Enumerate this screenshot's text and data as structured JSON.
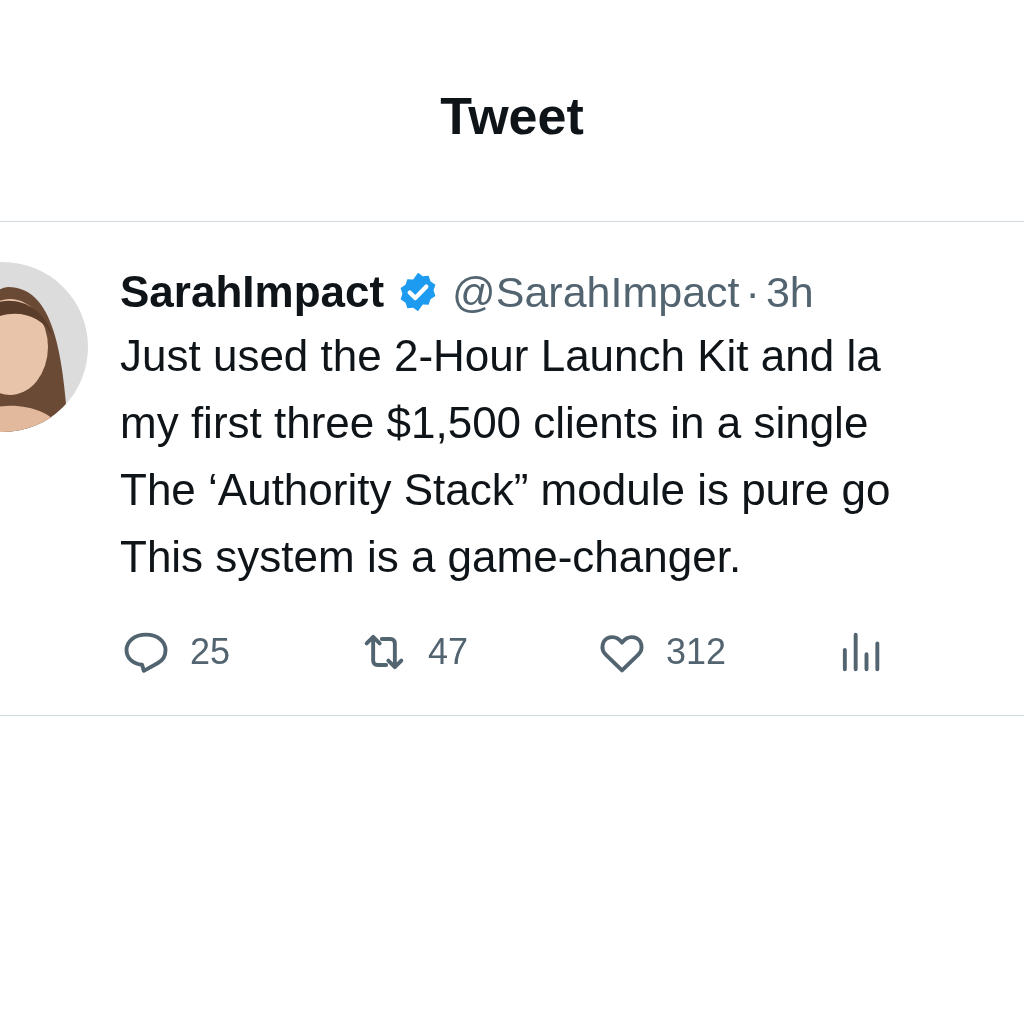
{
  "header": {
    "title": "Tweet"
  },
  "tweet": {
    "name": "SarahImpact",
    "verified": true,
    "handle": "@SarahImpact",
    "separator": "·",
    "time": "3h",
    "lines": [
      "Just used the 2-Hour Launch Kit and la",
      "my first three $1,500 clients in a single",
      "The ‘Authority Stack” module is pure go",
      "This system is a game-changer."
    ],
    "actions": [
      {
        "kind": "reply",
        "count": "25"
      },
      {
        "kind": "retweet",
        "count": "47"
      },
      {
        "kind": "like",
        "count": "312"
      },
      {
        "kind": "views"
      }
    ]
  }
}
